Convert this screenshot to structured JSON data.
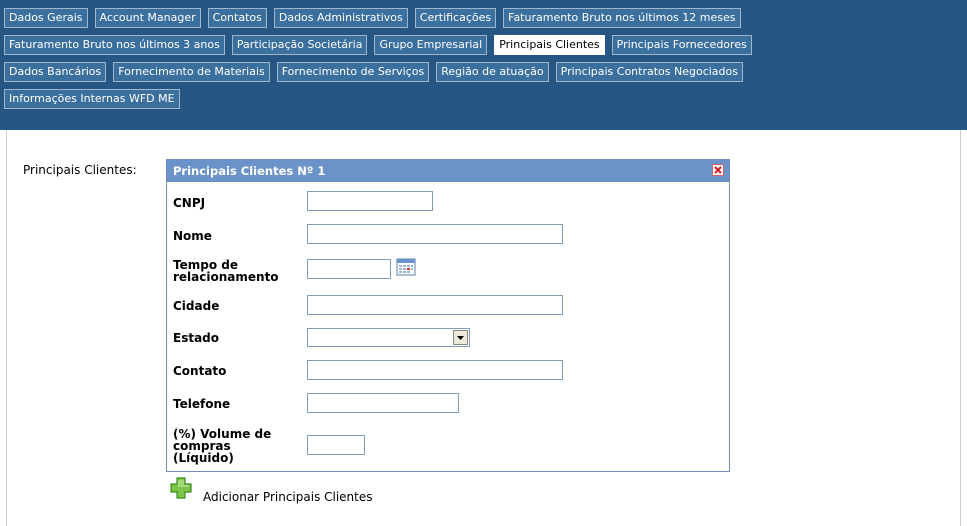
{
  "tabs": [
    [
      "Dados Gerais",
      "Account Manager",
      "Contatos",
      "Dados Administrativos",
      "Certificações",
      "Faturamento Bruto nos últimos 12 meses"
    ],
    [
      "Faturamento Bruto nos últimos 3 anos",
      "Participação Societária",
      "Grupo Empresarial",
      "Principais Clientes",
      "Principais Fornecedores"
    ],
    [
      "Dados Bancários",
      "Fornecimento de Materiais",
      "Fornecimento de Serviços",
      "Região de atuação",
      "Principais Contratos Negociados"
    ],
    [
      "Informações Internas WFD ME"
    ]
  ],
  "active_tab": "Principais Clientes",
  "section_label": "Principais Clientes:",
  "panel": {
    "title": "Principais Clientes Nº 1",
    "close_icon": "close-icon",
    "fields": {
      "cnpj": {
        "label": "CNPJ",
        "value": ""
      },
      "nome": {
        "label": "Nome",
        "value": ""
      },
      "tempo": {
        "label_line1": "Tempo de",
        "label_line2": "relacionamento",
        "value": ""
      },
      "cidade": {
        "label": "Cidade",
        "value": ""
      },
      "estado": {
        "label": "Estado",
        "value": ""
      },
      "contato": {
        "label": "Contato",
        "value": ""
      },
      "telefone": {
        "label": "Telefone",
        "value": ""
      },
      "volume": {
        "label_line1": "(%) Volume de",
        "label_line2": "compras",
        "label_line3": "(Líquido)",
        "value": ""
      }
    }
  },
  "add_link": "Adicionar Principais Clientes",
  "icons": {
    "calendar": "calendar-icon",
    "add": "plus-icon"
  },
  "colors": {
    "tab_bar": "#255684",
    "panel_header": "#6b93c9",
    "active_tab": "#ffffff"
  }
}
